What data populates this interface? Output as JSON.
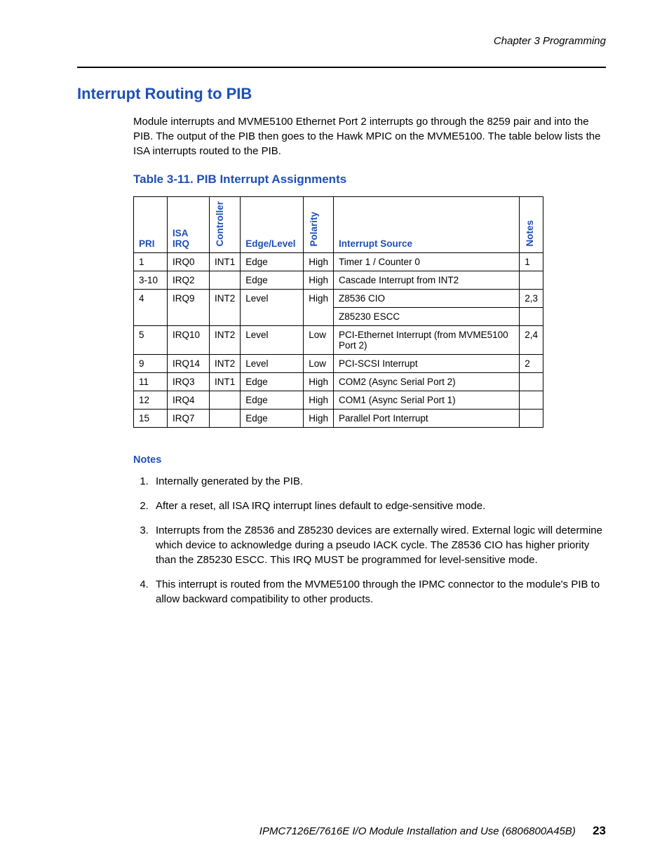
{
  "header": {
    "chapter": "Chapter 3  Programming"
  },
  "section": {
    "title": "Interrupt Routing to PIB",
    "paragraph": "Module interrupts and MVME5100 Ethernet Port 2 interrupts go through the 8259 pair and into the PIB. The output of the PIB then goes to the Hawk MPIC on the MVME5100. The table below lists the ISA interrupts routed to the PIB."
  },
  "table": {
    "title": "Table 3-11. PIB Interrupt Assignments",
    "headers": {
      "pri": "PRI",
      "irq": "ISA IRQ",
      "controller": "Controller",
      "edge": "Edge/Level",
      "polarity": "Polarity",
      "source": "Interrupt Source",
      "notes": "Notes"
    },
    "rows": [
      {
        "pri": "1",
        "irq": "IRQ0",
        "ctrl": "INT1",
        "edge": "Edge",
        "pol": "High",
        "src": "Timer 1 / Counter 0",
        "notes": "1"
      },
      {
        "pri": "3-10",
        "irq": "IRQ2",
        "ctrl": "",
        "edge": "Edge",
        "pol": "High",
        "src": "Cascade Interrupt from INT2",
        "notes": ""
      },
      {
        "pri": "4",
        "irq": "IRQ9",
        "ctrl": "INT2",
        "edge": "Level",
        "pol": "High",
        "src": "Z8536 CIO",
        "notes": "2,3"
      },
      {
        "pri": "",
        "irq": "",
        "ctrl": "",
        "edge": "",
        "pol": "",
        "src": "Z85230 ESCC",
        "notes": ""
      },
      {
        "pri": "5",
        "irq": "IRQ10",
        "ctrl": "INT2",
        "edge": "Level",
        "pol": "Low",
        "src": "PCI-Ethernet Interrupt (from MVME5100 Port 2)",
        "notes": "2,4"
      },
      {
        "pri": "9",
        "irq": "IRQ14",
        "ctrl": "INT2",
        "edge": "Level",
        "pol": "Low",
        "src": "PCI-SCSI Interrupt",
        "notes": "2"
      },
      {
        "pri": "11",
        "irq": "IRQ3",
        "ctrl": "INT1",
        "edge": "Edge",
        "pol": "High",
        "src": "COM2 (Async Serial Port 2)",
        "notes": ""
      },
      {
        "pri": "12",
        "irq": "IRQ4",
        "ctrl": "",
        "edge": "Edge",
        "pol": "High",
        "src": "COM1 (Async Serial Port 1)",
        "notes": ""
      },
      {
        "pri": "15",
        "irq": "IRQ7",
        "ctrl": "",
        "edge": "Edge",
        "pol": "High",
        "src": "Parallel Port Interrupt",
        "notes": ""
      }
    ]
  },
  "notes": {
    "heading": "Notes",
    "items": [
      "Internally generated by the PIB.",
      "After a reset, all ISA IRQ interrupt lines default to edge-sensitive mode.",
      "Interrupts from the Z8536 and Z85230 devices are externally wired. External logic will determine which device to acknowledge during a pseudo IACK cycle. The Z8536 CIO has higher priority than the Z85230 ESCC. This IRQ MUST be programmed for level-sensitive mode.",
      "This interrupt is routed from the MVME5100 through the IPMC connector to the module's PIB to allow backward compatibility to other products."
    ]
  },
  "footer": {
    "doc": "IPMC7126E/7616E I/O Module Installation and Use (6806800A45B)",
    "page": "23"
  }
}
